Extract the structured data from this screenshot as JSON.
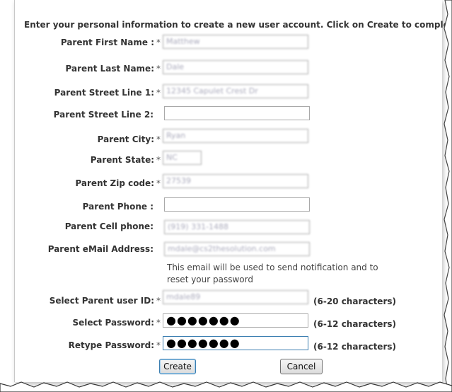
{
  "intro_text": "Enter your personal information to create a new user account.  Click on Create to complete",
  "required_marker": "*",
  "fields": {
    "first_name": {
      "label": "Parent First Name :",
      "value": "Matthew"
    },
    "last_name": {
      "label": "Parent Last Name:",
      "value": "Dale"
    },
    "street1": {
      "label": "Parent Street Line 1:",
      "value": "12345 Capulet Crest Dr"
    },
    "street2": {
      "label": "Parent Street Line 2:",
      "value": ""
    },
    "city": {
      "label": "Parent City:",
      "value": "Ryan"
    },
    "state": {
      "label": "Parent State:",
      "value": "NC"
    },
    "zip": {
      "label": "Parent Zip code:",
      "value": "27539"
    },
    "phone": {
      "label": "Parent Phone :",
      "value": ""
    },
    "cell": {
      "label": "Parent Cell phone:",
      "value": "(919) 331-1488"
    },
    "email": {
      "label": "Parent eMail Address:",
      "value": "mdale@cs2thesolution.com"
    },
    "userid": {
      "label": "Select Parent user ID:",
      "value": "mdale89",
      "hint": "(6-20 characters)"
    },
    "password": {
      "label": "Select Password:",
      "value": "●●●●●●●",
      "hint": "(6-12 characters)"
    },
    "retype": {
      "label": "Retype Password:",
      "value": "●●●●●●●",
      "hint": "(6-12 characters)"
    }
  },
  "email_note": "This email will be used to send notification and to reset your password",
  "buttons": {
    "create": "Create",
    "cancel": "Cancel"
  }
}
